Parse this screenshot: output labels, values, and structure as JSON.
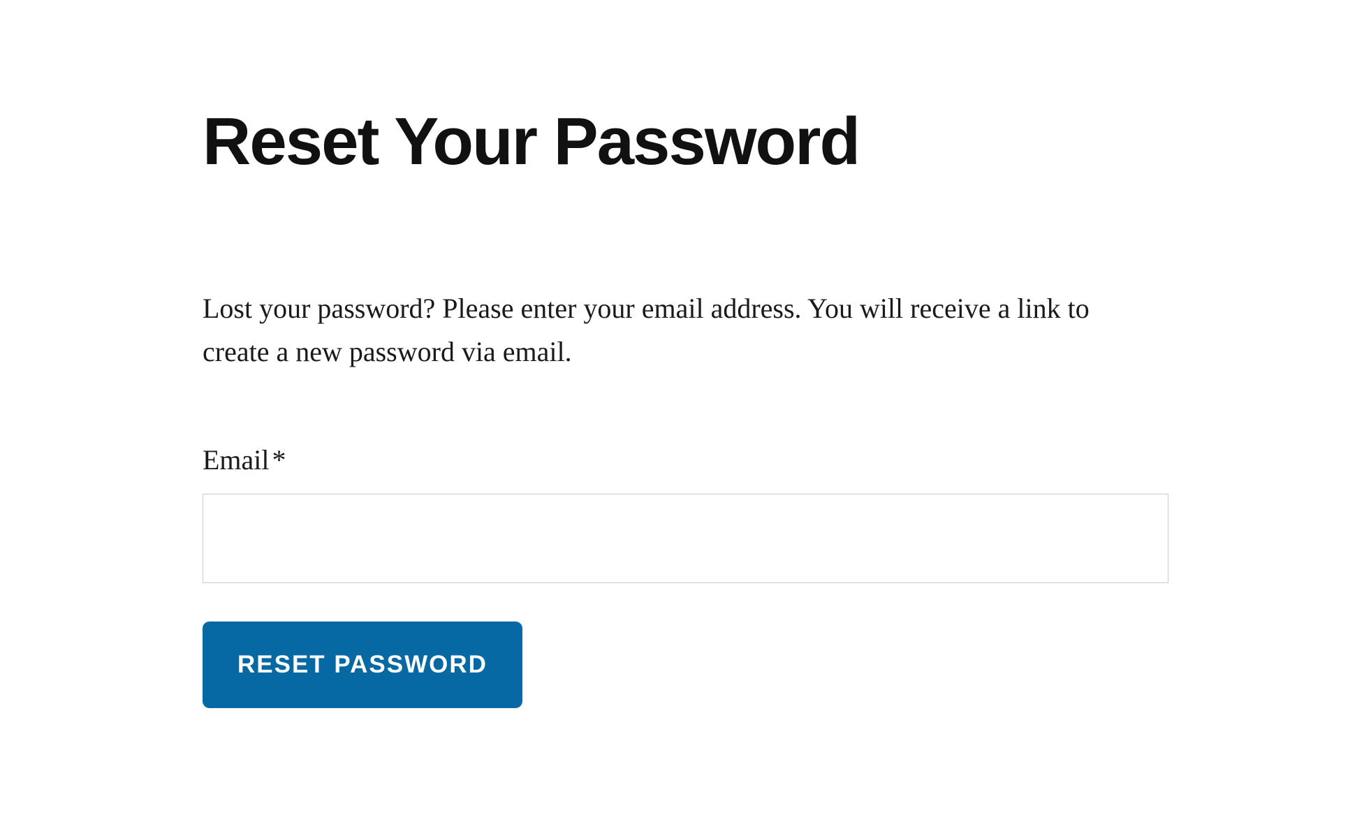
{
  "page": {
    "title": "Reset Your Password",
    "description": "Lost your password? Please enter your email address. You will receive a link to create a new password via email."
  },
  "form": {
    "email": {
      "label": "Email",
      "required_marker": "*",
      "value": "",
      "placeholder": ""
    },
    "submit_label": "RESET PASSWORD"
  },
  "colors": {
    "button_bg": "#0669a3",
    "button_text": "#ffffff",
    "text": "#1a1a1a",
    "heading": "#111111",
    "input_border": "#cccccc"
  }
}
